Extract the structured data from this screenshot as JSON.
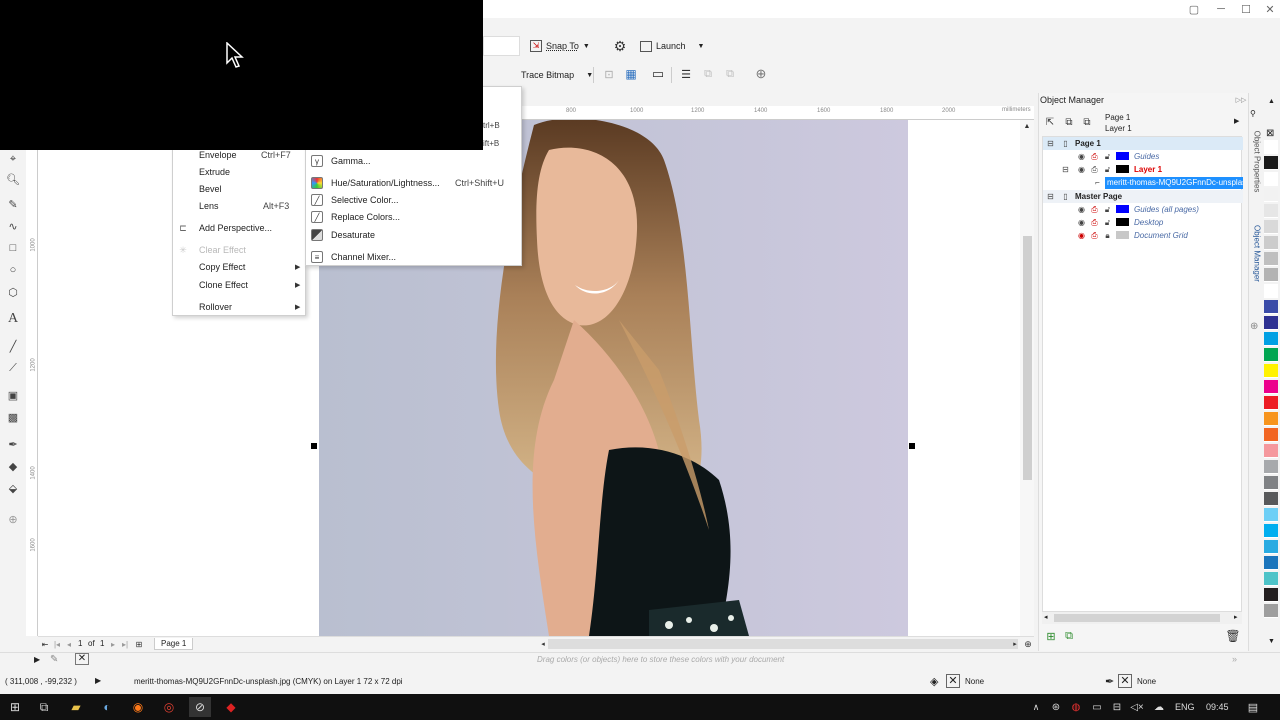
{
  "window": {
    "min_label": "─",
    "max_label": "☐",
    "close_label": "✕"
  },
  "toolbar1": {
    "snap_to": "Snap To",
    "launch": "Launch"
  },
  "toolbar2": {
    "trace_bitmap": "Trace Bitmap"
  },
  "ruler": {
    "unit": "millimeters",
    "h_ticks": [
      "800",
      "1000",
      "1200",
      "1400",
      "1600",
      "1800",
      "2000"
    ],
    "v_ticks": [
      "1000",
      "1200",
      "1400",
      "1600"
    ]
  },
  "effects_menu": {
    "items": [
      {
        "label": "Envelope",
        "shortcut": "Ctrl+F7"
      },
      {
        "label": "Extrude",
        "shortcut": ""
      },
      {
        "label": "Bevel",
        "shortcut": ""
      },
      {
        "label": "Lens",
        "shortcut": "Alt+F3"
      },
      {
        "label": "Add Perspective...",
        "shortcut": ""
      },
      {
        "label": "Clear Effect",
        "shortcut": ""
      },
      {
        "label": "Copy Effect",
        "shortcut": ""
      },
      {
        "label": "Clone Effect",
        "shortcut": ""
      },
      {
        "label": "Rollover",
        "shortcut": ""
      }
    ]
  },
  "adjust_menu": {
    "partial_shortcuts": [
      "trl+B",
      "ift+B"
    ],
    "items": [
      {
        "label": "Gamma...",
        "shortcut": ""
      },
      {
        "label": "Hue/Saturation/Lightness...",
        "shortcut": "Ctrl+Shift+U"
      },
      {
        "label": "Selective Color...",
        "shortcut": ""
      },
      {
        "label": "Replace Colors...",
        "shortcut": ""
      },
      {
        "label": "Desaturate",
        "shortcut": ""
      },
      {
        "label": "Channel Mixer...",
        "shortcut": ""
      }
    ]
  },
  "object_manager": {
    "title": "Object Manager",
    "header_page": "Page 1",
    "header_layer": "Layer 1",
    "tree": [
      {
        "label": "Page 1",
        "kind": "page"
      },
      {
        "label": "Guides",
        "kind": "layer",
        "color": "#0000ff"
      },
      {
        "label": "Layer 1",
        "kind": "layer-active",
        "color": "#000000"
      },
      {
        "label": "meritt-thomas-MQ9U2GFnnDc-unsplash",
        "kind": "object"
      },
      {
        "label": "Master Page",
        "kind": "page"
      },
      {
        "label": "Guides (all pages)",
        "kind": "master",
        "color": "#0000ff"
      },
      {
        "label": "Desktop",
        "kind": "master",
        "color": "#000000"
      },
      {
        "label": "Document Grid",
        "kind": "master",
        "color": "#c8c8c8"
      }
    ],
    "tab_properties": "Object Properties",
    "tab_manager": "Object Manager"
  },
  "page_nav": {
    "current": "1",
    "of": "of",
    "total": "1",
    "tab": "Page 1"
  },
  "doc_palette_hint": "Drag colors (or objects) here to store these colors with your document",
  "status": {
    "coords": "( 311,008 , -99,232 )",
    "info": "meritt-thomas-MQ9U2GFnnDc-unsplash.jpg (CMYK) on Layer 1 72 x 72 dpi",
    "fill": "None",
    "outline": "None"
  },
  "taskbar": {
    "lang": "ENG",
    "time": "09:45"
  },
  "palette_colors": [
    "#ffffff",
    "#1a1a1a",
    "#ffffff",
    "#f2f2f2",
    "#e6e6e6",
    "#d9d9d9",
    "#cccccc",
    "#bfbfbf",
    "#b3b3b3",
    "#ffffff",
    "#3a4ba8",
    "#2e3192",
    "#00a0e3",
    "#00a651",
    "#fff200",
    "#ec008c",
    "#ed1c24",
    "#f7941d",
    "#f26522",
    "#f5989d",
    "#a7a9ac",
    "#808285",
    "#58595b",
    "#6dcff6",
    "#00aeef",
    "#29abe2",
    "#1b75bc",
    "#4dc3c8",
    "#231f20",
    "#9e9e9e"
  ]
}
